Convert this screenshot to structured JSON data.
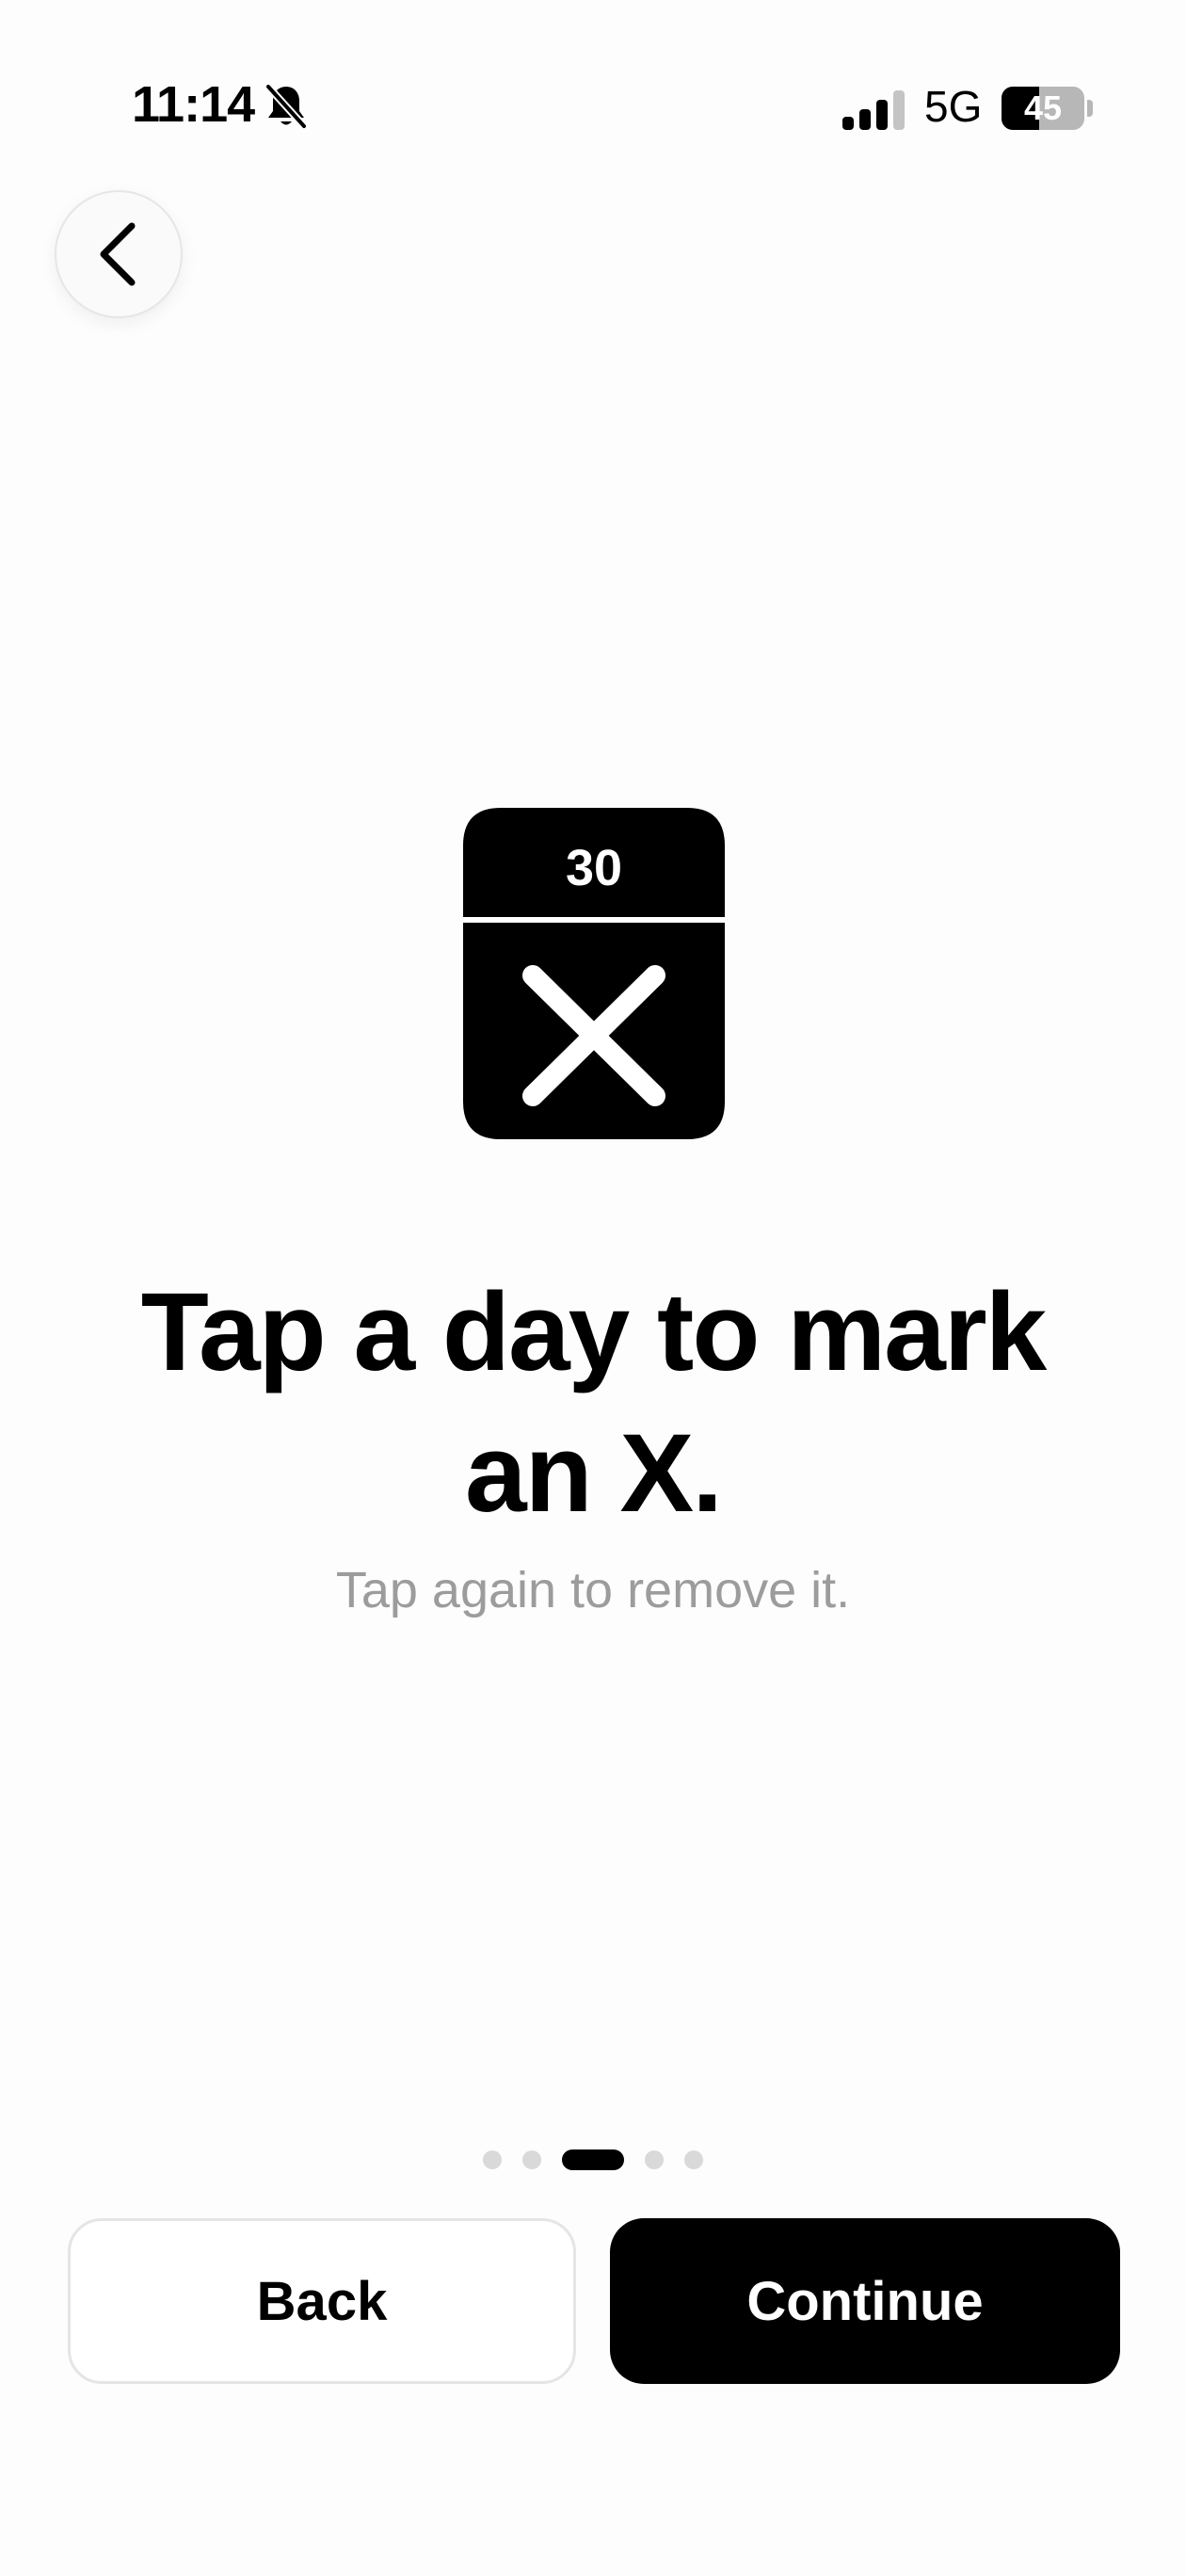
{
  "status_bar": {
    "time": "11:14",
    "network": "5G",
    "battery_level": "45",
    "battery_fraction": 0.45,
    "icons": [
      "bell-slash-icon",
      "signal-bars-icon",
      "battery-icon"
    ]
  },
  "nav": {
    "back_icon": "chevron-left-icon"
  },
  "illustration": {
    "icon": "calendar-x-icon",
    "day_number": "30"
  },
  "content": {
    "title_line1": "Tap a day to mark",
    "title_line2": "an X.",
    "subtitle": "Tap again to remove it."
  },
  "pager": {
    "count": 5,
    "active_index": 2
  },
  "buttons": {
    "back_label": "Back",
    "continue_label": "Continue"
  },
  "colors": {
    "primary": "#000000",
    "muted_text": "#9c9c9c",
    "dot_inactive": "#d9d9d9",
    "background": "#fdfdfd"
  }
}
